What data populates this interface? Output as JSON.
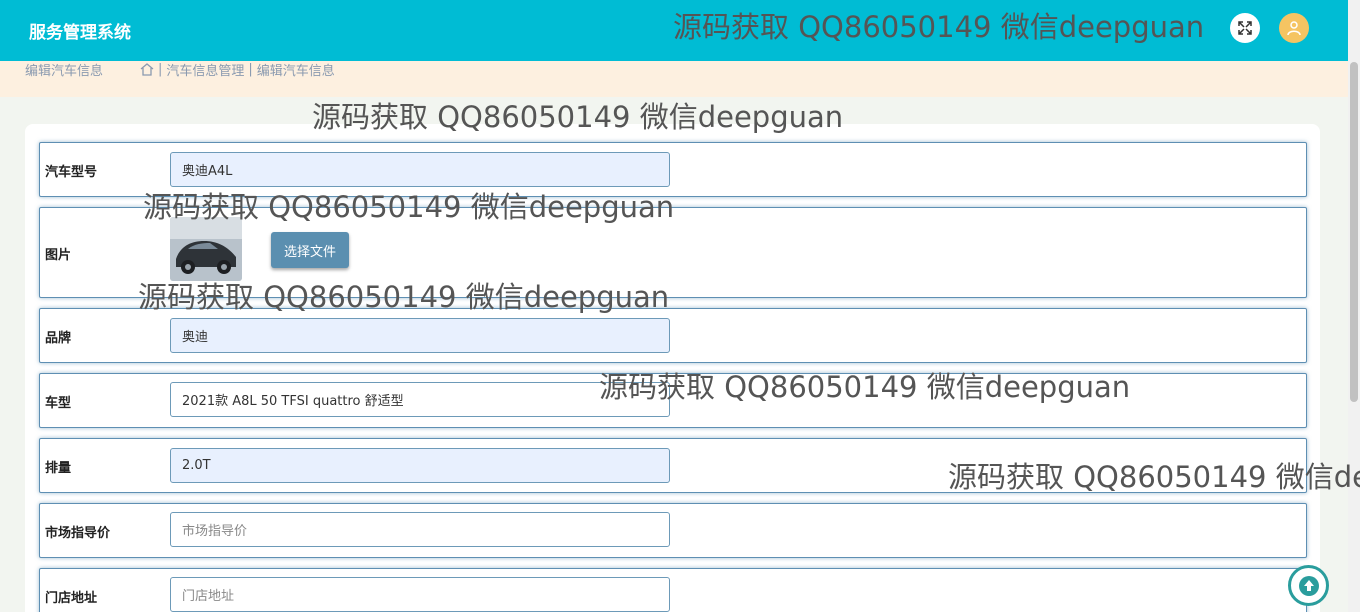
{
  "header": {
    "app_title": "服务管理系统",
    "watermark": "源码获取 QQ86050149 微信deepguan"
  },
  "breadcrumb": {
    "page": "编辑汽车信息",
    "trail": [
      "汽车信息管理",
      "编辑汽车信息"
    ],
    "separator": "|"
  },
  "watermarks": [
    "源码获取 QQ86050149 微信deepguan",
    "源码获取 QQ86050149 微信deepguan",
    "源码获取 QQ86050149 微信deepguan",
    "源码获取 QQ86050149 微信deepguan",
    "源码获取 QQ86050149 微信de"
  ],
  "form": {
    "model": {
      "label": "汽车型号",
      "value": "奥迪A4L"
    },
    "image": {
      "label": "图片",
      "button": "选择文件"
    },
    "brand": {
      "label": "品牌",
      "value": "奥迪"
    },
    "car_type": {
      "label": "车型",
      "value": "2021款 A8L 50 TFSI quattro 舒适型"
    },
    "displacement": {
      "label": "排量",
      "value": "2.0T"
    },
    "price": {
      "label": "市场指导价",
      "placeholder": "市场指导价"
    },
    "address": {
      "label": "门店地址",
      "placeholder": "门店地址"
    }
  },
  "colors": {
    "topbar": "#00bcd4",
    "breadcrumb_bg": "#fdf0e0",
    "row_border": "#5e8fb3",
    "button": "#5b8fb0",
    "avatar": "#f5c462"
  }
}
